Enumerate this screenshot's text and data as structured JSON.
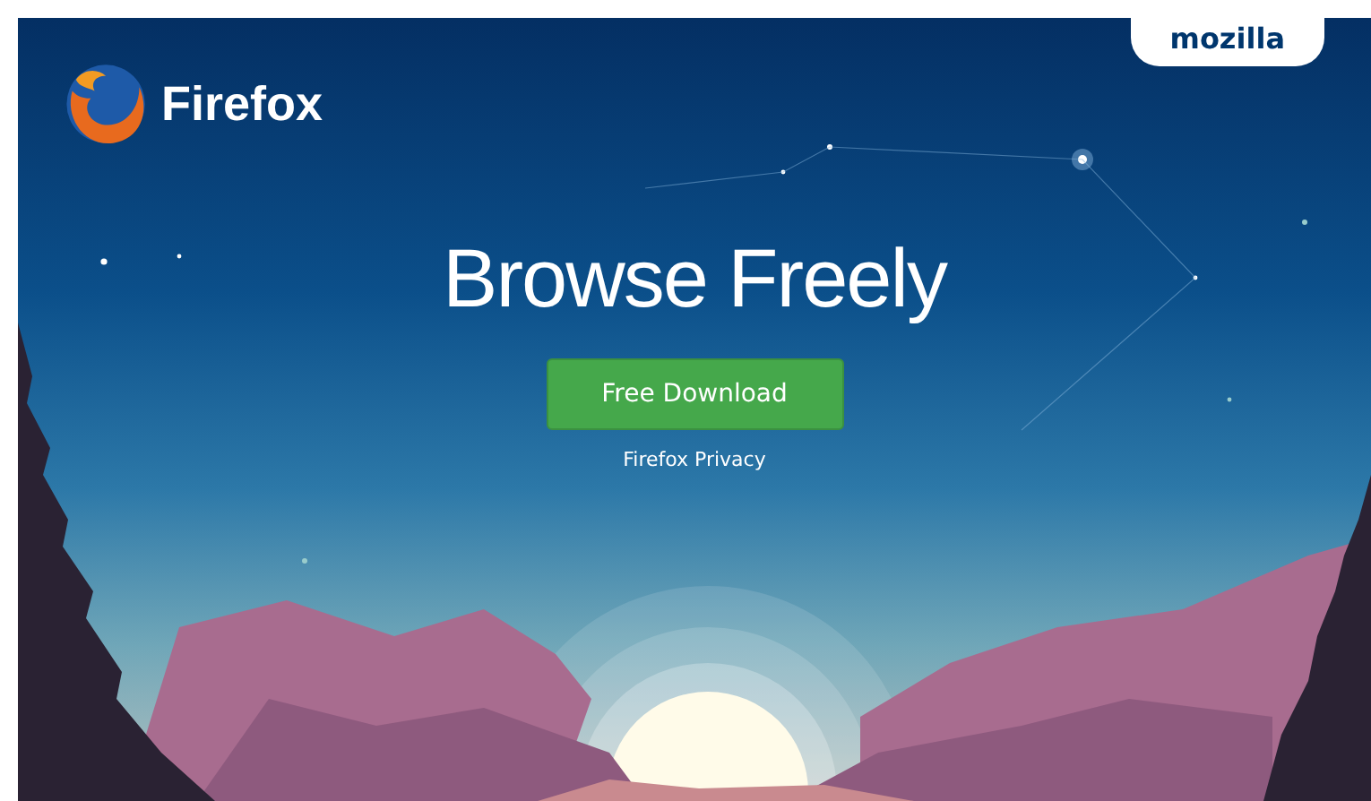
{
  "header": {
    "logo_text": "Firefox",
    "mozilla_tab": "mozilla"
  },
  "hero": {
    "title": "Browse Freely",
    "download_button": "Free Download",
    "privacy_link": "Firefox Privacy"
  }
}
